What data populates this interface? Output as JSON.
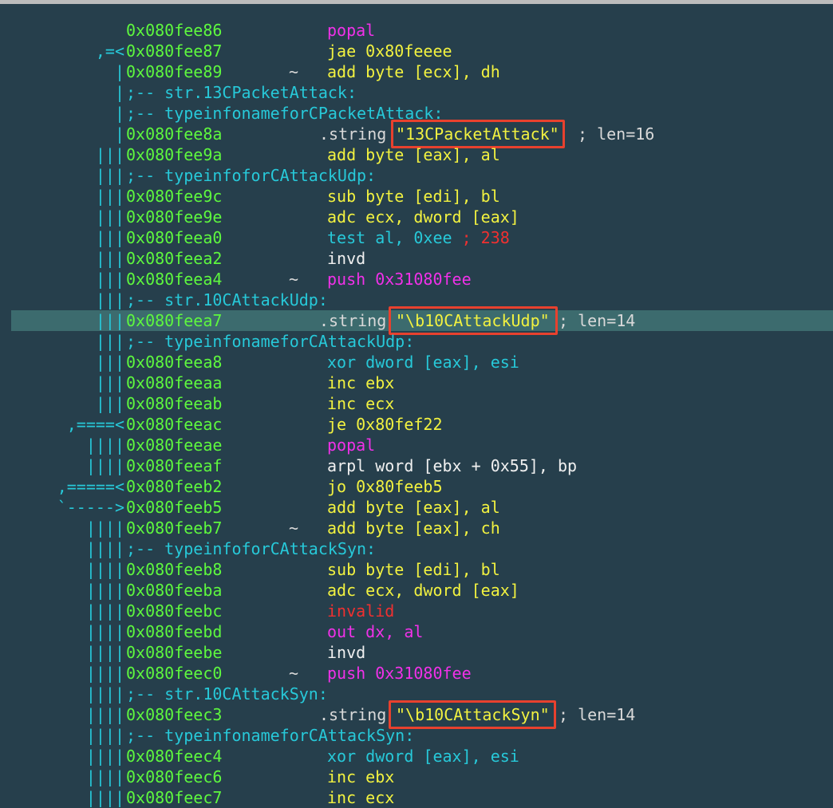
{
  "rows": [
    {
      "gutter": "",
      "addr": "0x080fee86",
      "tilde": "",
      "parts": [
        {
          "t": "popal",
          "c": "mag"
        }
      ]
    },
    {
      "gutter": ",=<",
      "addr": "0x080fee87",
      "tilde": "",
      "parts": [
        {
          "t": "jae 0x80feeee",
          "c": "ylw"
        }
      ]
    },
    {
      "gutter": "|",
      "addr": "0x080fee89",
      "tilde": "~",
      "parts": [
        {
          "t": "add byte [ecx], dh",
          "c": "ylw"
        }
      ]
    },
    {
      "gutter": "|",
      "flag": ";-- str.13CPacketAttack:"
    },
    {
      "gutter": "|",
      "flag": ";-- typeinfonameforCPacketAttack:"
    },
    {
      "gutter": "|",
      "addr": "0x080fee8a",
      "string": "\"13CPacketAttack\"",
      "len": "; len=16",
      "lenx": 724
    },
    {
      "gutter": "|||",
      "addr": "0x080fee9a",
      "tilde": "",
      "parts": [
        {
          "t": "add byte [eax], al",
          "c": "ylw"
        }
      ]
    },
    {
      "gutter": "|||",
      "flag": ";-- typeinfoforCAttackUdp:"
    },
    {
      "gutter": "|||",
      "addr": "0x080fee9c",
      "tilde": "",
      "parts": [
        {
          "t": "sub byte [edi], bl",
          "c": "ylw"
        }
      ]
    },
    {
      "gutter": "|||",
      "addr": "0x080fee9e",
      "tilde": "",
      "parts": [
        {
          "t": "adc ecx, dword [eax]",
          "c": "ylw"
        }
      ]
    },
    {
      "gutter": "|||",
      "addr": "0x080feea0",
      "tilde": "",
      "parts": [
        {
          "t": "test al, 0xee",
          "c": "cyn"
        },
        {
          "t": " ; 238",
          "c": "red"
        }
      ]
    },
    {
      "gutter": "|||",
      "addr": "0x080feea2",
      "tilde": "",
      "parts": [
        {
          "t": "invd",
          "c": "wht"
        }
      ]
    },
    {
      "gutter": "|||",
      "addr": "0x080feea4",
      "tilde": "~",
      "parts": [
        {
          "t": "push 0x31080fee",
          "c": "mag"
        }
      ]
    },
    {
      "gutter": "|||",
      "flag": ";-- str.10CAttackUdp:"
    },
    {
      "gutter": "|||",
      "addr": "0x080feea7",
      "string": "\"\\b10CAttackUdp\"",
      "len": "; len=14",
      "lenx": 700,
      "sel": true
    },
    {
      "gutter": "|||",
      "flag": ";-- typeinfonameforCAttackUdp:"
    },
    {
      "gutter": "|||",
      "addr": "0x080feea8",
      "tilde": "",
      "parts": [
        {
          "t": "xor dword [eax], esi",
          "c": "cyn"
        }
      ]
    },
    {
      "gutter": "|||",
      "addr": "0x080feeaa",
      "tilde": "",
      "parts": [
        {
          "t": "inc ebx",
          "c": "ylw"
        }
      ]
    },
    {
      "gutter": "|||",
      "addr": "0x080feeab",
      "tilde": "",
      "parts": [
        {
          "t": "inc ecx",
          "c": "ylw"
        }
      ]
    },
    {
      "gutter": ",====<",
      "addr": "0x080feeac",
      "tilde": "",
      "parts": [
        {
          "t": "je 0x80fef22",
          "c": "ylw"
        }
      ]
    },
    {
      "gutter": "||||",
      "addr": "0x080feeae",
      "tilde": "",
      "parts": [
        {
          "t": "popal",
          "c": "mag"
        }
      ]
    },
    {
      "gutter": "||||",
      "addr": "0x080feeaf",
      "tilde": "",
      "parts": [
        {
          "t": "arpl word [ebx + 0x55], bp",
          "c": "wht"
        }
      ]
    },
    {
      "gutter": ",=====<",
      "addr": "0x080feeb2",
      "tilde": "",
      "parts": [
        {
          "t": "jo 0x80feeb5",
          "c": "ylw"
        }
      ]
    },
    {
      "gutter": "`----->",
      "addr": "0x080feeb5",
      "tilde": "",
      "parts": [
        {
          "t": "add byte [eax], al",
          "c": "ylw"
        }
      ]
    },
    {
      "gutter": "||||",
      "addr": "0x080feeb7",
      "tilde": "~",
      "parts": [
        {
          "t": "add byte [eax], ch",
          "c": "ylw"
        }
      ]
    },
    {
      "gutter": "||||",
      "flag": ";-- typeinfoforCAttackSyn:"
    },
    {
      "gutter": "||||",
      "addr": "0x080feeb8",
      "tilde": "",
      "parts": [
        {
          "t": "sub byte [edi], bl",
          "c": "ylw"
        }
      ]
    },
    {
      "gutter": "||||",
      "addr": "0x080feeba",
      "tilde": "",
      "parts": [
        {
          "t": "adc ecx, dword [eax]",
          "c": "ylw"
        }
      ]
    },
    {
      "gutter": "||||",
      "addr": "0x080feebc",
      "tilde": "",
      "parts": [
        {
          "t": "invalid",
          "c": "red"
        }
      ]
    },
    {
      "gutter": "||||",
      "addr": "0x080feebd",
      "tilde": "",
      "parts": [
        {
          "t": "out dx, al",
          "c": "mag"
        }
      ]
    },
    {
      "gutter": "||||",
      "addr": "0x080feebe",
      "tilde": "",
      "parts": [
        {
          "t": "invd",
          "c": "wht"
        }
      ]
    },
    {
      "gutter": "||||",
      "addr": "0x080feec0",
      "tilde": "~",
      "parts": [
        {
          "t": "push 0x31080fee",
          "c": "mag"
        }
      ]
    },
    {
      "gutter": "||||",
      "flag": ";-- str.10CAttackSyn:"
    },
    {
      "gutter": "||||",
      "addr": "0x080feec3",
      "string": "\"\\b10CAttackSyn\"",
      "len": "; len=14",
      "lenx": 700
    },
    {
      "gutter": "||||",
      "flag": ";-- typeinfonameforCAttackSyn:"
    },
    {
      "gutter": "||||",
      "addr": "0x080feec4",
      "tilde": "",
      "parts": [
        {
          "t": "xor dword [eax], esi",
          "c": "cyn"
        }
      ]
    },
    {
      "gutter": "||||",
      "addr": "0x080feec6",
      "tilde": "",
      "parts": [
        {
          "t": "inc ebx",
          "c": "ylw"
        }
      ]
    },
    {
      "gutter": "||||",
      "addr": "0x080feec7",
      "tilde": "",
      "parts": [
        {
          "t": "inc ecx",
          "c": "ylw"
        }
      ]
    }
  ],
  "string_keyword": ".string",
  "highlight_color": "#e8412e"
}
